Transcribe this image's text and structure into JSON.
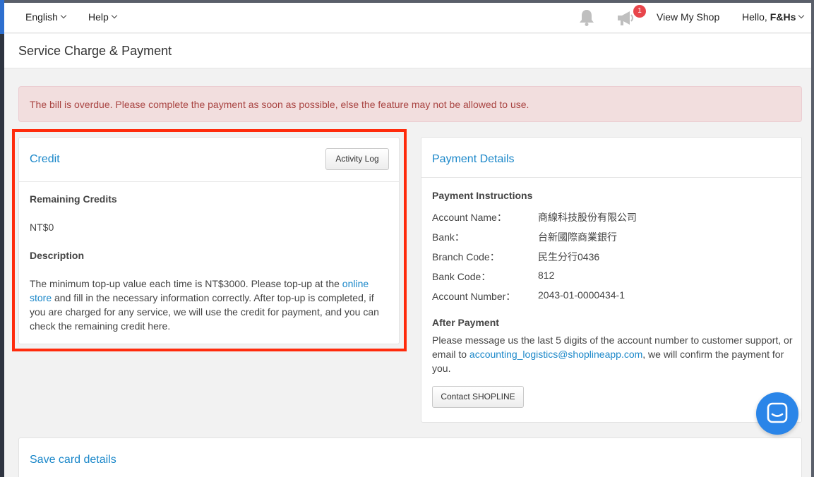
{
  "topbar": {
    "language": "English",
    "help": "Help",
    "notification_count": "1",
    "view_shop": "View My Shop",
    "greeting": "Hello,",
    "username": "F&Hs"
  },
  "page": {
    "title": "Service Charge & Payment"
  },
  "alert": {
    "message": "The bill is overdue. Please complete the payment as soon as possible, else the feature may not be allowed to use."
  },
  "credit": {
    "title": "Credit",
    "activity_log": "Activity Log",
    "remaining_label": "Remaining Credits",
    "remaining_value": "NT$0",
    "description_label": "Description",
    "description_before_link": "The minimum top-up value each time is NT$3000. Please top-up at the ",
    "description_link": "online store",
    "description_after_link": " and fill in the necessary information correctly. After top-up is completed, if you are charged for any service, we will use the credit for payment, and you can check the remaining credit here."
  },
  "payment": {
    "title": "Payment Details",
    "instructions_label": "Payment Instructions",
    "fields": [
      {
        "key": "Account Name：",
        "value": "商線科技股份有限公司"
      },
      {
        "key": "Bank：",
        "value": "台新國際商業銀行"
      },
      {
        "key": "Branch Code：",
        "value": "民生分行0436"
      },
      {
        "key": "Bank Code：",
        "value": "812"
      },
      {
        "key": "Account Number：",
        "value": "2043-01-0000434-1"
      }
    ],
    "after_label": "After Payment",
    "after_before_link": "Please message us the last 5 digits of the account number to customer support, or email to ",
    "after_link": "accounting_logistics@shoplineapp.com",
    "after_after_link": ", we will confirm the payment for you.",
    "contact_button": "Contact SHOPLINE"
  },
  "save_card": {
    "title": "Save card details"
  },
  "colors": {
    "accent": "#1a87c9",
    "alert_bg": "#f2dede",
    "alert_text": "#a94442",
    "highlight": "#ff2b0c",
    "chat_button": "#2a85e8"
  }
}
